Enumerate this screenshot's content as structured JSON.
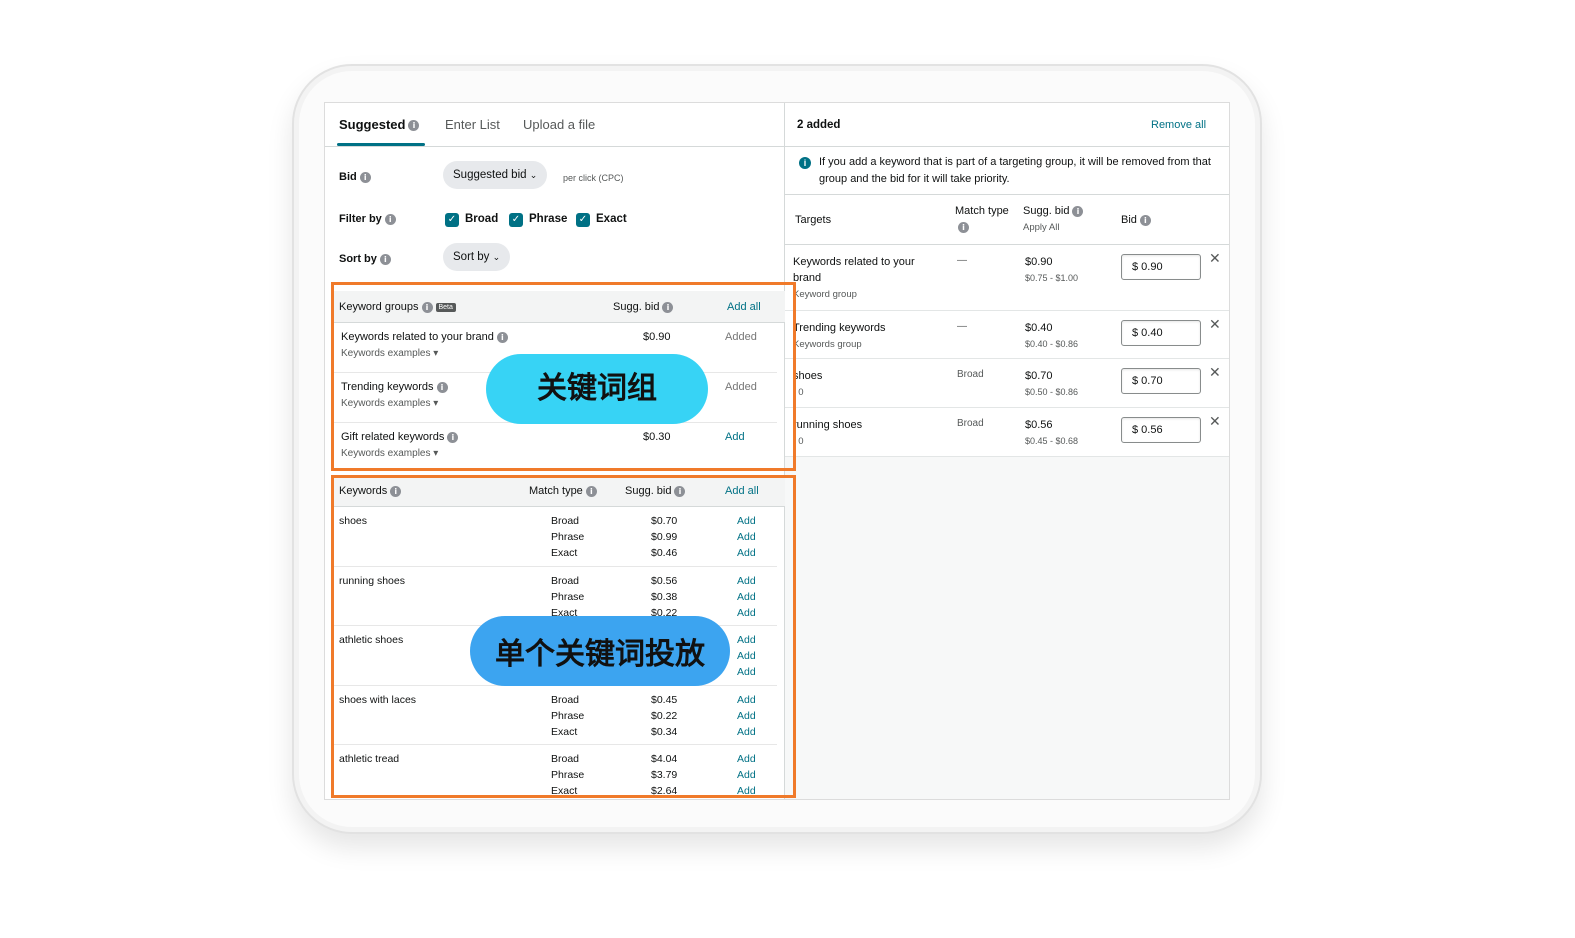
{
  "tabs": [
    {
      "label": "Suggested"
    },
    {
      "label": "Enter List"
    },
    {
      "label": "Upload a file"
    }
  ],
  "bid": {
    "label": "Bid",
    "value": "Suggested bid",
    "note": "per click (CPC)"
  },
  "filter": {
    "label": "Filter by",
    "options": [
      "Broad",
      "Phrase",
      "Exact"
    ]
  },
  "sort": {
    "label": "Sort by",
    "value": "Sort by"
  },
  "keyword_groups": {
    "title": "Keyword groups",
    "badge": "Beta",
    "bid_header": "Sugg. bid",
    "add_all": "Add all",
    "rows": [
      {
        "name": "Keywords related to your brand",
        "sub": "Keywords examples",
        "bid": "$0.90",
        "action": "Added"
      },
      {
        "name": "Trending keywords",
        "sub": "Keywords examples",
        "bid": "",
        "action": "Added"
      },
      {
        "name": "Gift related keywords",
        "sub": "Keywords examples",
        "bid": "$0.30",
        "action": "Add"
      }
    ]
  },
  "keywords": {
    "title": "Keywords",
    "match_header": "Match type",
    "bid_header": "Sugg. bid",
    "add_all": "Add all",
    "items": [
      {
        "name": "shoes",
        "lines": [
          {
            "match": "Broad",
            "bid": "$0.70",
            "action": "Add"
          },
          {
            "match": "Phrase",
            "bid": "$0.99",
            "action": "Add"
          },
          {
            "match": "Exact",
            "bid": "$0.46",
            "action": "Add"
          }
        ]
      },
      {
        "name": "running shoes",
        "lines": [
          {
            "match": "Broad",
            "bid": "$0.56",
            "action": "Add"
          },
          {
            "match": "Phrase",
            "bid": "$0.38",
            "action": "Add"
          },
          {
            "match": "Exact",
            "bid": "$0.22",
            "action": "Add"
          }
        ]
      },
      {
        "name": "athletic shoes",
        "lines": [
          {
            "match": "",
            "bid": "",
            "action": "Add"
          },
          {
            "match": "",
            "bid": "",
            "action": "Add"
          },
          {
            "match": "",
            "bid": "",
            "action": "Add"
          }
        ]
      },
      {
        "name": "shoes with laces",
        "lines": [
          {
            "match": "Broad",
            "bid": "$0.45",
            "action": "Add"
          },
          {
            "match": "Phrase",
            "bid": "$0.22",
            "action": "Add"
          },
          {
            "match": "Exact",
            "bid": "$0.34",
            "action": "Add"
          }
        ]
      },
      {
        "name": "athletic tread",
        "lines": [
          {
            "match": "Broad",
            "bid": "$4.04",
            "action": "Add"
          },
          {
            "match": "Phrase",
            "bid": "$3.79",
            "action": "Add"
          },
          {
            "match": "Exact",
            "bid": "$2.64",
            "action": "Add"
          }
        ]
      }
    ]
  },
  "right": {
    "added_count": "2 added",
    "remove_all": "Remove all",
    "alert": "If you add a keyword that is part of a targeting group, it will be removed from that group and the bid for it will take priority.",
    "headers": {
      "targets": "Targets",
      "match": "Match type",
      "sugg": "Sugg. bid",
      "apply_all": "Apply All",
      "bid": "Bid"
    },
    "rows": [
      {
        "name": "Keywords related to your brand",
        "sub": "Keyword group",
        "match": "—",
        "bid": "$0.90",
        "range": "$0.75 - $1.00",
        "input": "$ 0.90"
      },
      {
        "name": "Trending keywords",
        "sub": "Keywords group",
        "match": "—",
        "bid": "$0.40",
        "range": "$0.40 - $0.86",
        "input": "$ 0.40"
      },
      {
        "name": "shoes",
        "sub": ": 0",
        "match": "Broad",
        "bid": "$0.70",
        "range": "$0.50 - $0.86",
        "input": "$ 0.70"
      },
      {
        "name": "running shoes",
        "sub": ": 0",
        "match": "Broad",
        "bid": "$0.56",
        "range": "$0.45 - $0.68",
        "input": "$ 0.56"
      }
    ]
  },
  "callouts": {
    "groups": "关键词组",
    "single": "单个关键词投放"
  },
  "colors": {
    "accent": "#007185",
    "highlight": "#f07a2a",
    "callout1": "#37d3f5",
    "callout2": "#3ca4f0"
  }
}
